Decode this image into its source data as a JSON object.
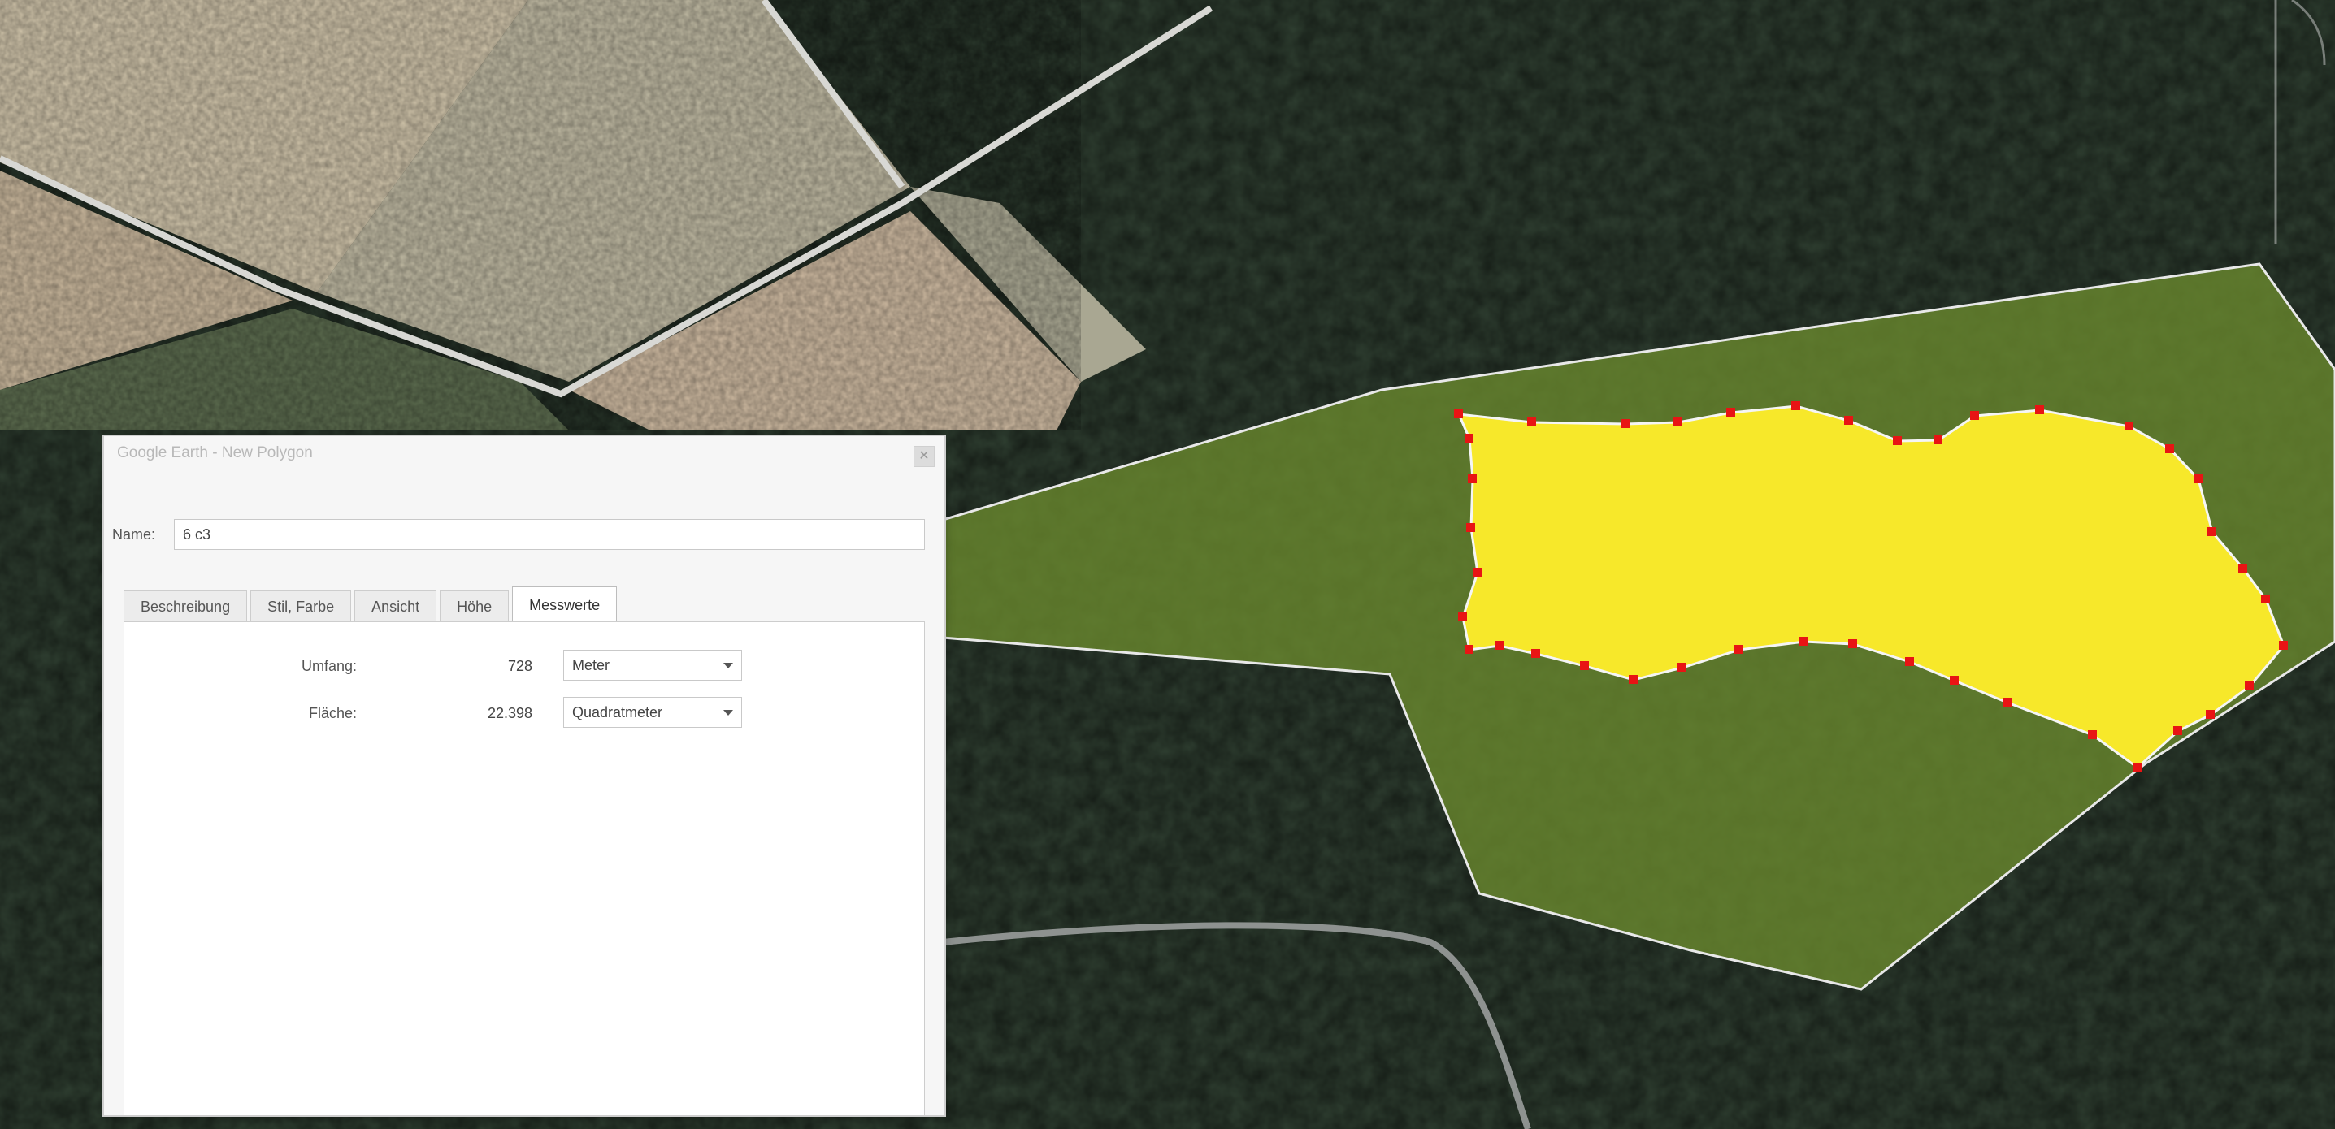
{
  "dialog": {
    "title": "Google Earth - New Polygon",
    "close_icon": "close-icon",
    "name_label": "Name:",
    "name_value": "6 c3",
    "tabs": [
      {
        "label": "Beschreibung"
      },
      {
        "label": "Stil, Farbe"
      },
      {
        "label": "Ansicht"
      },
      {
        "label": "Höhe"
      },
      {
        "label": "Messwerte",
        "active": true
      }
    ],
    "measurements": {
      "perimeter": {
        "label": "Umfang:",
        "value": "728",
        "unit": "Meter"
      },
      "area": {
        "label": "Fläche:",
        "value": "22.398",
        "unit": "Quadratmeter"
      }
    }
  },
  "map": {
    "type": "satellite",
    "colors": {
      "forest": "#2b3a2c",
      "outer_polygon": "#6b8a2e",
      "inner_polygon": "#f7e82a",
      "vertex": "#e81414",
      "outline": "#f2f2f2",
      "road": "#8e8e8e"
    }
  }
}
